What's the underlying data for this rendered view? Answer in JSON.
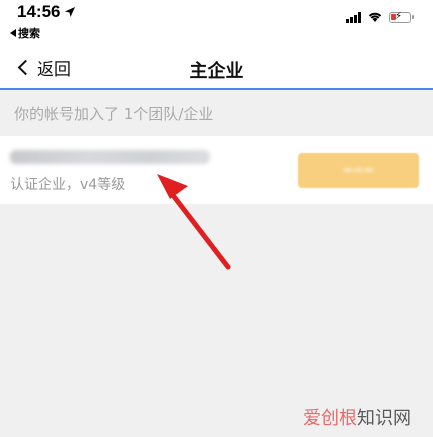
{
  "status_bar": {
    "time": "14:56",
    "back_app": "搜索"
  },
  "nav": {
    "back_label": "返回",
    "title": "主企业"
  },
  "team_info": "你的帐号加入了 1个团队/企业",
  "company": {
    "level": "认证企业，v4等级"
  },
  "watermark": {
    "red_part": "爱创根",
    "gray_part": "知识网"
  },
  "colors": {
    "accent": "#4a86e8",
    "button": "#f7cf7e",
    "arrow": "#e02020"
  }
}
